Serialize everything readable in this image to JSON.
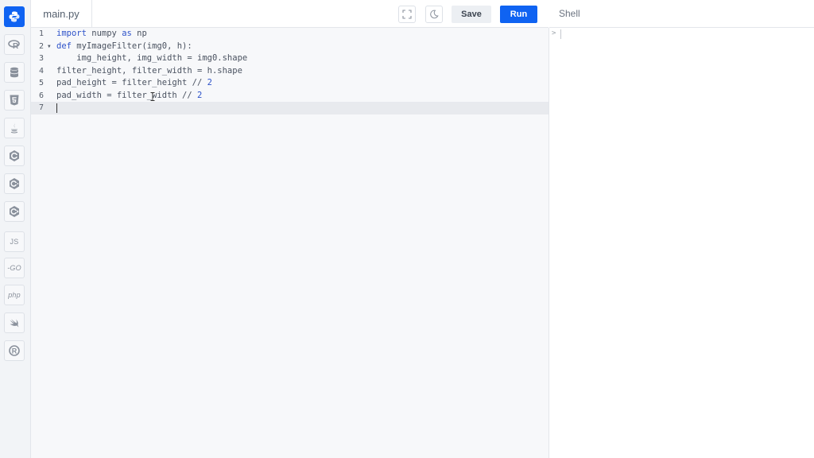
{
  "editor": {
    "file_tab": "main.py",
    "save_label": "Save",
    "run_label": "Run",
    "lines": [
      {
        "n": "1",
        "text": "import numpy as np"
      },
      {
        "n": "2",
        "text": "def myImageFilter(img0, h):"
      },
      {
        "n": "3",
        "text": "    img_height, img_width = img0.shape"
      },
      {
        "n": "4",
        "text": "filter_height, filter_width = h.shape"
      },
      {
        "n": "5",
        "text": "pad_height = filter_height // 2"
      },
      {
        "n": "6",
        "text": "pad_width = filter_width // 2"
      },
      {
        "n": "7",
        "text": ""
      }
    ]
  },
  "shell": {
    "title": "Shell",
    "prompt": ">"
  },
  "sidebar": {
    "languages": [
      {
        "name": "python",
        "icon": "python-icon",
        "active": true
      },
      {
        "name": "r",
        "icon": "r-icon"
      },
      {
        "name": "sql",
        "icon": "database-icon"
      },
      {
        "name": "html",
        "icon": "html5-icon"
      },
      {
        "name": "java",
        "icon": "java-icon"
      },
      {
        "name": "c",
        "icon": "c-icon"
      },
      {
        "name": "cpp",
        "icon": "cpp-icon"
      },
      {
        "name": "csharp",
        "icon": "csharp-icon"
      },
      {
        "name": "javascript",
        "icon": "js-icon",
        "label": "JS"
      },
      {
        "name": "go",
        "icon": "go-icon",
        "label": "-GO"
      },
      {
        "name": "php",
        "icon": "php-icon",
        "label": "php"
      },
      {
        "name": "swift",
        "icon": "swift-icon"
      },
      {
        "name": "rust",
        "icon": "rust-icon"
      }
    ]
  },
  "colors": {
    "accent": "#0f63f2",
    "keyword": "#2d52c9",
    "number": "#2d52c9"
  }
}
